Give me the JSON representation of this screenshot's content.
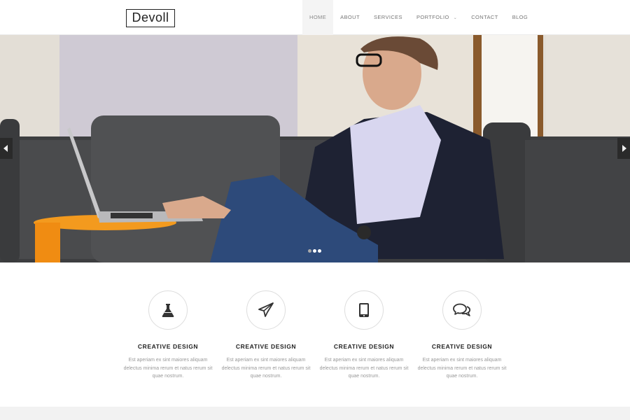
{
  "logo": {
    "text": "Devoll"
  },
  "nav": {
    "items": [
      {
        "label": "HOME"
      },
      {
        "label": "ABOUT"
      },
      {
        "label": "SERVICES"
      },
      {
        "label": "PORTFOLIO"
      },
      {
        "label": "CONTACT"
      },
      {
        "label": "BLOG"
      }
    ],
    "active_index": 0
  },
  "hero": {
    "slide_count": 3,
    "active_slide": 2
  },
  "features": [
    {
      "icon": "flask-icon",
      "title": "CREATIVE DESIGN",
      "desc": "Est aperiam ex sint maiores aliquam delectus minima rerum et natus rerum sit quae nostrum."
    },
    {
      "icon": "paper-plane-icon",
      "title": "CREATIVE DESIGN",
      "desc": "Est aperiam ex sint maiores aliquam delectus minima rerum et natus rerum sit quae nostrum."
    },
    {
      "icon": "tablet-icon",
      "title": "CREATIVE DESIGN",
      "desc": "Est aperiam ex sint maiores aliquam delectus minima rerum et natus rerum sit quae nostrum."
    },
    {
      "icon": "chat-bubbles-icon",
      "title": "CREATIVE DESIGN",
      "desc": "Est aperiam ex sint maiores aliquam delectus minima rerum et natus rerum sit quae nostrum."
    }
  ]
}
